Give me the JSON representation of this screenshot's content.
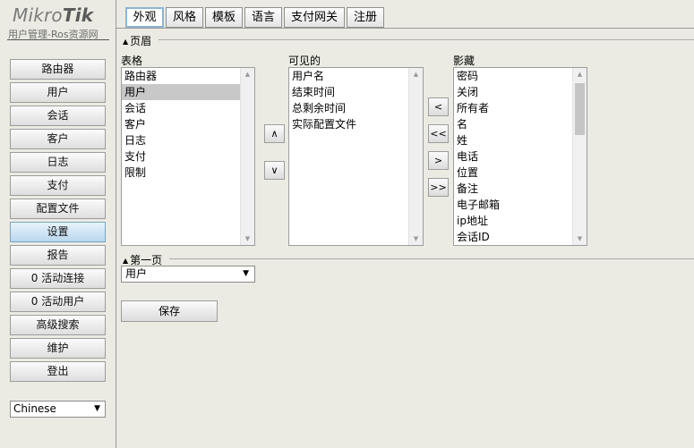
{
  "brand": {
    "logo_text_light": "Mikro",
    "logo_text_bold": "Tik",
    "subtitle": "用户管理-Ros资源网"
  },
  "sidebar": {
    "items": [
      {
        "label": "路由器"
      },
      {
        "label": "用户"
      },
      {
        "label": "会话"
      },
      {
        "label": "客户"
      },
      {
        "label": "日志"
      },
      {
        "label": "支付"
      },
      {
        "label": "配置文件"
      },
      {
        "label": "设置",
        "active": true
      },
      {
        "label": "报告"
      },
      {
        "label": "0 活动连接"
      },
      {
        "label": "0 活动用户"
      },
      {
        "label": "高级搜索"
      },
      {
        "label": "维护"
      },
      {
        "label": "登出"
      }
    ],
    "language": "Chinese"
  },
  "tabs": [
    {
      "label": "外观",
      "active": true
    },
    {
      "label": "风格"
    },
    {
      "label": "模板"
    },
    {
      "label": "语言"
    },
    {
      "label": "支付网关"
    },
    {
      "label": "注册"
    }
  ],
  "header_section": {
    "legend": "页眉",
    "tables_label": "表格",
    "visible_label": "可见的",
    "hidden_label": "影藏",
    "tables": [
      "路由器",
      "用户",
      "会话",
      "客户",
      "日志",
      "支付",
      "限制"
    ],
    "tables_selected_index": 1,
    "visible": [
      "用户名",
      "结束时间",
      "总剩余时间",
      "实际配置文件"
    ],
    "hidden": [
      "密码",
      "关闭",
      "所有者",
      "名",
      "姓",
      "电话",
      "位置",
      "备注",
      "电子邮箱",
      "ip地址",
      "会话ID"
    ],
    "up_button": "∧",
    "down_button": "∨",
    "move_left": "<",
    "move_all_left": "<<",
    "move_right": ">",
    "move_all_right": ">>"
  },
  "first_page_section": {
    "legend": "第一页",
    "selected": "用户"
  },
  "save_label": "保存"
}
